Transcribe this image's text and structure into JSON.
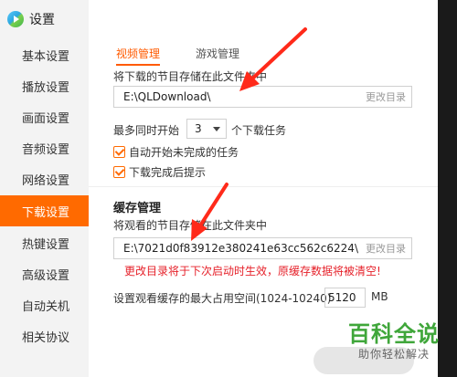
{
  "app": {
    "title": "设置"
  },
  "sidebar": {
    "items": [
      {
        "label": "基本设置",
        "active": false
      },
      {
        "label": "播放设置",
        "active": false
      },
      {
        "label": "画面设置",
        "active": false
      },
      {
        "label": "音频设置",
        "active": false
      },
      {
        "label": "网络设置",
        "active": false
      },
      {
        "label": "下载设置",
        "active": true
      },
      {
        "label": "热键设置",
        "active": false
      },
      {
        "label": "高级设置",
        "active": false
      },
      {
        "label": "自动关机",
        "active": false
      },
      {
        "label": "相关协议",
        "active": false
      }
    ]
  },
  "tabs": [
    {
      "label": "视频管理",
      "active": true
    },
    {
      "label": "游戏管理",
      "active": false
    }
  ],
  "download": {
    "folder_prompt": "将下载的节目存储在此文件夹中",
    "folder_path": "E:\\QLDownload\\",
    "change_dir_label": "更改目录",
    "max_tasks_prefix": "最多同时开始",
    "max_tasks_value": "3",
    "max_tasks_suffix": "个下载任务",
    "auto_resume_label": "自动开始未完成的任务",
    "auto_resume_checked": true,
    "notify_done_label": "下载完成后提示",
    "notify_done_checked": true
  },
  "cache": {
    "section_title": "缓存管理",
    "folder_prompt": "将观看的节目存储在此文件夹中",
    "folder_path": "E:\\7021d0f83912e380241e63cc562c6224\\",
    "change_dir_label": "更改目录",
    "warning": "更改目录将于下次启动时生效，原缓存数据将被清空!",
    "max_space_label": "设置观看缓存的最大占用空间(1024-10240)",
    "max_space_value": "5120",
    "max_space_unit": "MB"
  },
  "watermark": {
    "title": "百科全说",
    "subtitle": "助你轻松解决"
  },
  "colors": {
    "accent": "#ff6a00",
    "warning": "#e6212a",
    "arrow": "#ff2a1a",
    "watermark": "#3fa63a"
  }
}
